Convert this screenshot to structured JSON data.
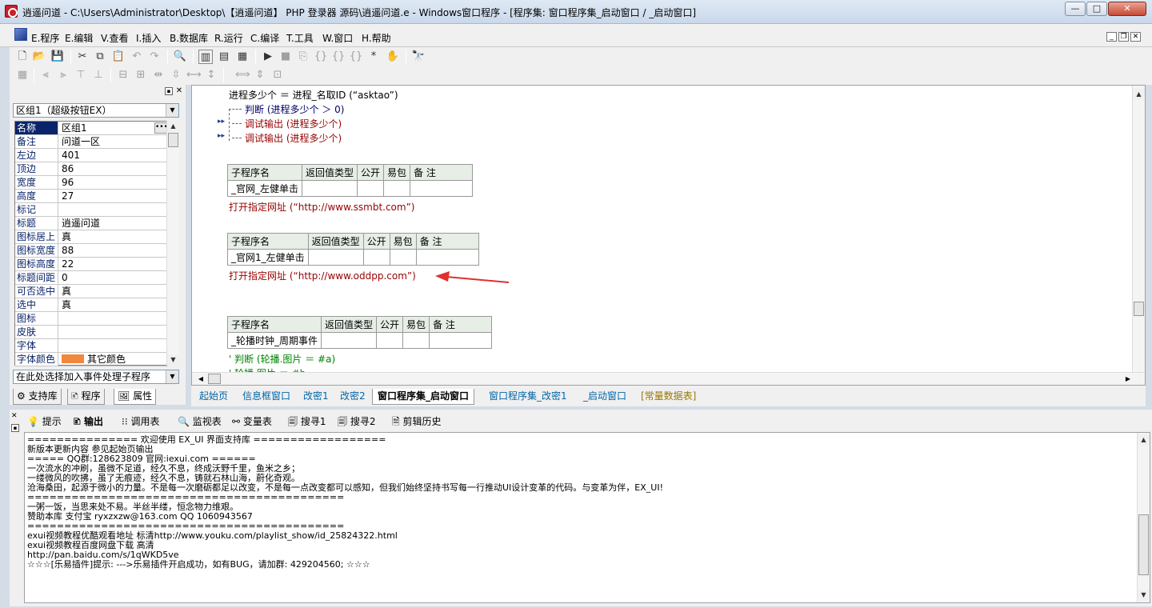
{
  "window": {
    "title": "逍遥问道 - C:\\Users\\Administrator\\Desktop\\【逍遥问道】 PHP 登录器 源码\\逍遥问道.e - Windows窗口程序 - [程序集: 窗口程序集_启动窗口 / _启动窗口]",
    "btn_min": "—",
    "btn_max": "□",
    "btn_close": "✕"
  },
  "menu": {
    "items": [
      "E.程序",
      "E.编辑",
      "V.查看",
      "I.插入",
      "B.数据库",
      "R.运行",
      "C.编译",
      "T.工具",
      "W.窗口",
      "H.帮助"
    ]
  },
  "left": {
    "component": "区组1（超级按钮EX）",
    "props": [
      {
        "name": "名称",
        "value": "区组1"
      },
      {
        "name": "备注",
        "value": "问道一区"
      },
      {
        "name": "左边",
        "value": "401"
      },
      {
        "name": "顶边",
        "value": "86"
      },
      {
        "name": "宽度",
        "value": "96"
      },
      {
        "name": "高度",
        "value": "27"
      },
      {
        "name": "标记",
        "value": ""
      },
      {
        "name": "标题",
        "value": "逍遥问道"
      },
      {
        "name": "图标居上",
        "value": "真"
      },
      {
        "name": "图标宽度",
        "value": "88"
      },
      {
        "name": "图标高度",
        "value": "22"
      },
      {
        "name": "标题间距",
        "value": "0"
      },
      {
        "name": "可否选中",
        "value": "真"
      },
      {
        "name": "选中",
        "value": "真"
      },
      {
        "name": "图标",
        "value": ""
      },
      {
        "name": "皮肤",
        "value": ""
      },
      {
        "name": "字体",
        "value": ""
      },
      {
        "name": "字体颜色",
        "value": "其它颜色"
      }
    ],
    "event_combo": "在此处选择加入事件处理子程序",
    "tabs": [
      "支持库",
      "程序",
      "属性"
    ]
  },
  "editor": {
    "line1": "进程多少个 ＝ 进程_名取ID (“asktao”)",
    "line2": "判断 (进程多少个 ＞ 0)",
    "line3": "调试输出 (进程多少个)",
    "line4": "调试输出 (进程多少个)",
    "table_headers": [
      "子程序名",
      "返回值类型",
      "公开",
      "易包",
      "备 注"
    ],
    "sub1": "_官网_左健单击",
    "sub1_code": "打开指定网址 (“http://www.ssmbt.com”)",
    "sub2": "_官网1_左健单击",
    "sub2_code": "打开指定网址 (“http://www.oddpp.com”)",
    "sub3": "_轮播时钟_周期事件",
    "line_c1": "' 判断 (轮播.图片 ＝ #a)",
    "line_c2": "' 轮播.图片 ＝ #b"
  },
  "editor_tabs": [
    "起始页",
    "信息框窗口",
    "改密1",
    "改密2",
    "窗口程序集_启动窗口",
    "窗口程序集_改密1",
    "_启动窗口",
    "[常量数据表]"
  ],
  "output": {
    "tabs": [
      "提示",
      "输出",
      "调用表",
      "监视表",
      "变量表",
      "搜寻1",
      "搜寻2",
      "剪辑历史"
    ],
    "lines": [
      "=============== 欢迎使用  EX_UI 界面支持库 ==================",
      "        新版本更新内容  参见起始页输出",
      "===== QQ群:128623809 官网:iexui.com ======",
      "一次流水的冲刷，虽微不足道，经久不息，终成沃野千里，鱼米之乡；",
      "一缕微风的吹拂，虽了无痕迹，经久不息，铸就石林山海，蔚化奇观。",
      "沧海桑田，起源于微小的力量。不是每一次磨砺都足以改变，不是每一点改变都可以感知，但我们始终坚持书写每一行推动UI设计变革的代码。与变革为伴，EX_UI!",
      "===========================================",
      "一粥一饭，当思来处不易。半丝半缕，恒念物力维艰。",
      "赞助本库 支付宝 ryxzxzw@163.com QQ 1060943567",
      "===========================================",
      "exui视频教程优酷观看地址 标清http://www.youku.com/playlist_show/id_25824322.html",
      "exui视频教程百度网盘下载 高清",
      "http://pan.baidu.com/s/1qWKD5ve",
      "☆☆☆[乐易插件]提示: --->乐易插件开启成功，如有BUG，请加群: 429204560; ☆☆☆"
    ]
  },
  "colors": {
    "accent": "#0a246a",
    "arrow": "#e03030",
    "swatch": "#f0883c"
  }
}
